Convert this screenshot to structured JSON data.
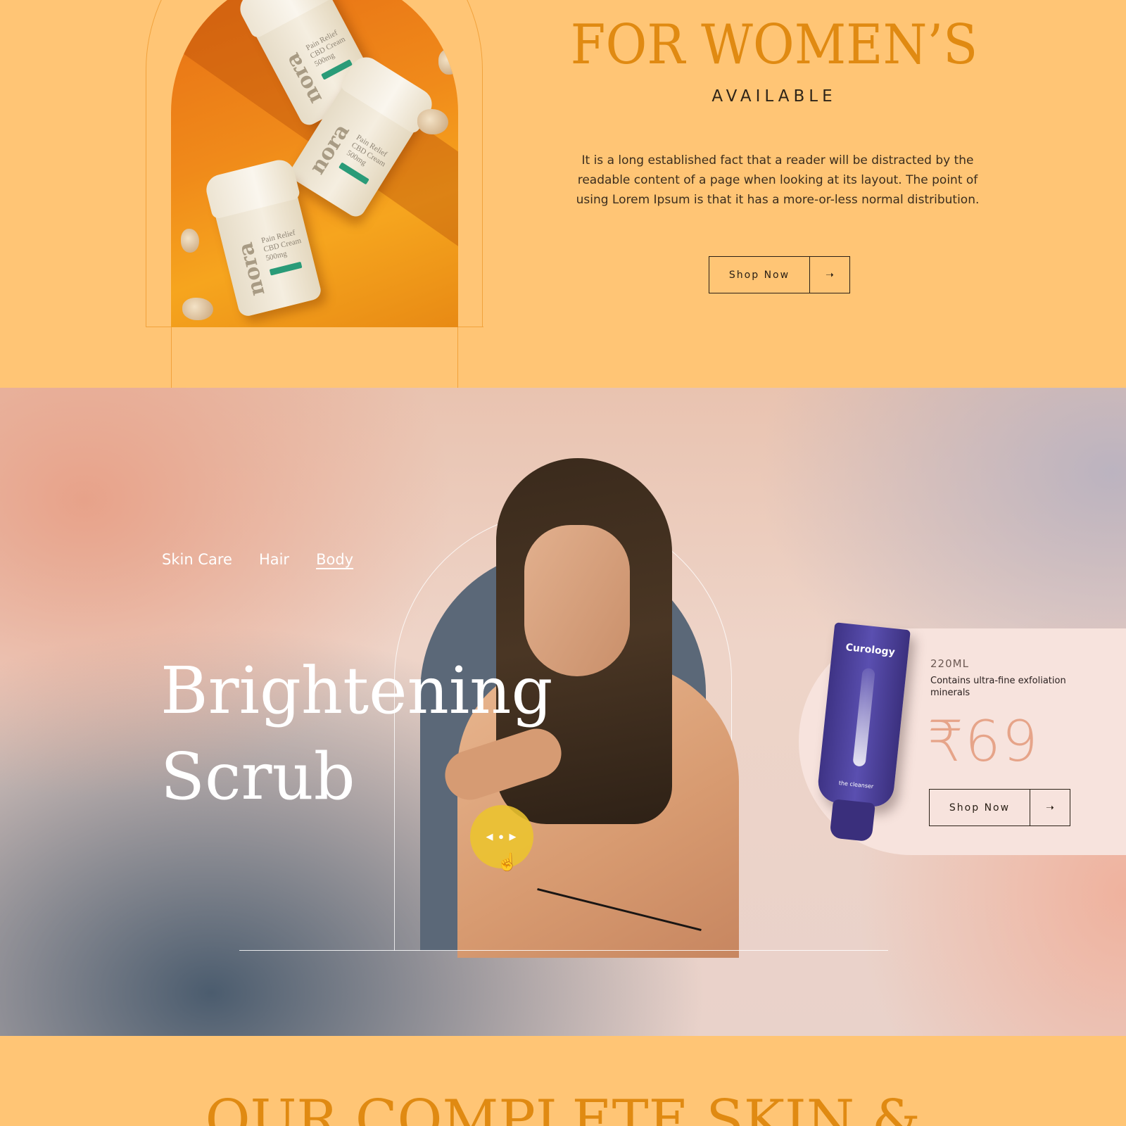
{
  "section_women": {
    "headline": "FOR WOMEN’S",
    "subheadline": "AVAILABLE",
    "body": "It is a long established fact that a reader will be distracted by the readable content of a page when looking at its layout. The point of using Lorem Ipsum is that it has a more-or-less normal distribution.",
    "shop_label": "Shop Now",
    "arrow": "➝",
    "jar_brand": "nora",
    "jar_lines": [
      "Pain Relief",
      "CBD Cream",
      "500mg"
    ]
  },
  "hero": {
    "categories": [
      "Skin Care",
      "Hair",
      "Body"
    ],
    "active_category": "Body",
    "title_line1": "Brightening",
    "title_line2": "Scrub",
    "slider_glyph": "◀ ● ▶",
    "cursor_glyph": "☝"
  },
  "product": {
    "brand": "Curology",
    "tube_sub": "the cleanser",
    "volume": "220ML",
    "description": "Contains ultra-fine exfoliation minerals",
    "price": "₹69",
    "shop_label": "Shop Now",
    "arrow": "➝"
  },
  "next_section": {
    "headline": "OUR COMPLETE SKIN &"
  },
  "colors": {
    "page_bg": "#ffc575",
    "headline_orange": "#e08a12",
    "price_peach": "#e6a489",
    "arch_slate": "#5b6878",
    "slider_yellow": "#ecc42e"
  }
}
